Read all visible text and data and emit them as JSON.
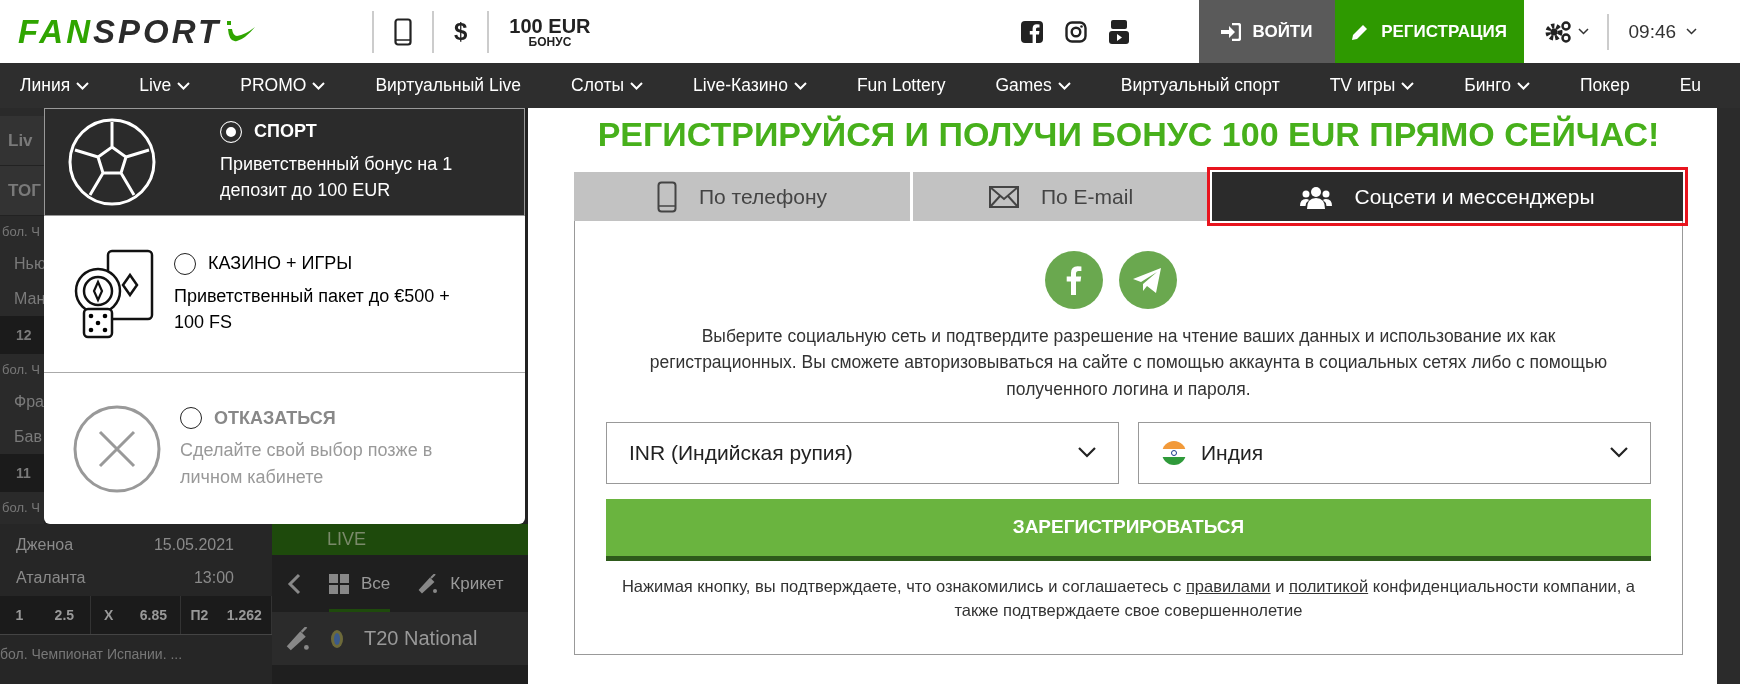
{
  "header": {
    "logo": {
      "part_1": "FAN",
      "part_2": "SPORT"
    },
    "currency_symbol": "$",
    "bonus": {
      "amount": "100 EUR",
      "label": "БОНУС"
    },
    "login_button": "ВОЙТИ",
    "register_button": "РЕГИСТРАЦИЯ",
    "time": "09:46"
  },
  "nav": [
    {
      "label": "Линия",
      "dropdown": true
    },
    {
      "label": "Live",
      "dropdown": true
    },
    {
      "label": "PROMO",
      "dropdown": true
    },
    {
      "label": "Виртуальный Live",
      "dropdown": false
    },
    {
      "label": "Слоты",
      "dropdown": true
    },
    {
      "label": "Live-Казино",
      "dropdown": true
    },
    {
      "label": "Fun Lottery",
      "dropdown": false
    },
    {
      "label": "Games",
      "dropdown": true
    },
    {
      "label": "Виртуальный спорт",
      "dropdown": false
    },
    {
      "label": "TV игры",
      "dropdown": true
    },
    {
      "label": "Бинго",
      "dropdown": true
    },
    {
      "label": "Покер",
      "dropdown": false
    },
    {
      "label": "Eu",
      "dropdown": false
    }
  ],
  "sidebar": {
    "fragments": [
      {
        "kind": "title",
        "text": "Liv"
      },
      {
        "kind": "title",
        "text": "ТОГ"
      },
      {
        "kind": "league",
        "text": "бол. Ч"
      },
      {
        "kind": "team",
        "text": "Нью"
      },
      {
        "kind": "team",
        "text": "Ман"
      },
      {
        "kind": "number",
        "text": "12"
      },
      {
        "kind": "league",
        "text": "бол. Ч"
      },
      {
        "kind": "team",
        "text": "Фра"
      },
      {
        "kind": "team",
        "text": "Бав"
      },
      {
        "kind": "number",
        "text": "11"
      },
      {
        "kind": "league",
        "text": "бол. Ч"
      }
    ],
    "events": [
      {
        "team": "Дженоа",
        "info": "15.05.2021"
      },
      {
        "team": "Аталанта",
        "info": "13:00"
      }
    ],
    "odds": [
      {
        "label": "1",
        "value": "2.5"
      },
      {
        "label": "X",
        "value": "6.85"
      },
      {
        "label": "П2",
        "value": "1.262"
      }
    ],
    "league": "бол. Чемпионат Испании. ..."
  },
  "live_panel": {
    "banner": "LIVE",
    "tabs": [
      {
        "label": "Все",
        "selected": true
      },
      {
        "label": "Крикет",
        "selected": false
      }
    ],
    "event": "T20 National"
  },
  "bonus_options": [
    {
      "kind": "sport",
      "title": "СПОРТ",
      "description": "Приветственный бонус на 1 депозит до 100 EUR",
      "selected": true
    },
    {
      "kind": "casino",
      "title": "КАЗИНО + ИГРЫ",
      "description": "Приветственный пакет до €500 + 100 FS",
      "selected": false
    },
    {
      "kind": "decline",
      "title": "ОТКАЗАТЬСЯ",
      "description": "Сделайте свой выбор позже в личном кабинете",
      "selected": false
    }
  ],
  "registration": {
    "title": "РЕГИСТРИРУЙСЯ И ПОЛУЧИ БОНУС 100 EUR ПРЯМО СЕЙЧАС!",
    "tabs": [
      {
        "label": "По телефону",
        "selected": false,
        "highlighted": false
      },
      {
        "label": "По E-mail",
        "selected": false,
        "highlighted": false
      },
      {
        "label": "Соцсети и мессенджеры",
        "selected": true,
        "highlighted": true
      }
    ],
    "note": "Выберите социальную сеть и подтвердите разрешение на чтение ваших данных и использование их как регистрационных. Вы сможете авторизовываться на сайте с помощью аккаунта в социальных сетях либо с помощью полученного логина и пароля.",
    "currency": "INR (Индийская рупия)",
    "country": "Индия",
    "submit": "ЗАРЕГИСТРИРОВАТЬСЯ",
    "terms": {
      "before": "Нажимая кнопку, вы подтверждаете, что ознакомились и соглашаетесь с",
      "link_1": "правилами",
      "middle": "и",
      "link_2": "политикой",
      "after": "конфиденциальности компании, а также подтверждаете свое совершеннолетие"
    }
  }
}
